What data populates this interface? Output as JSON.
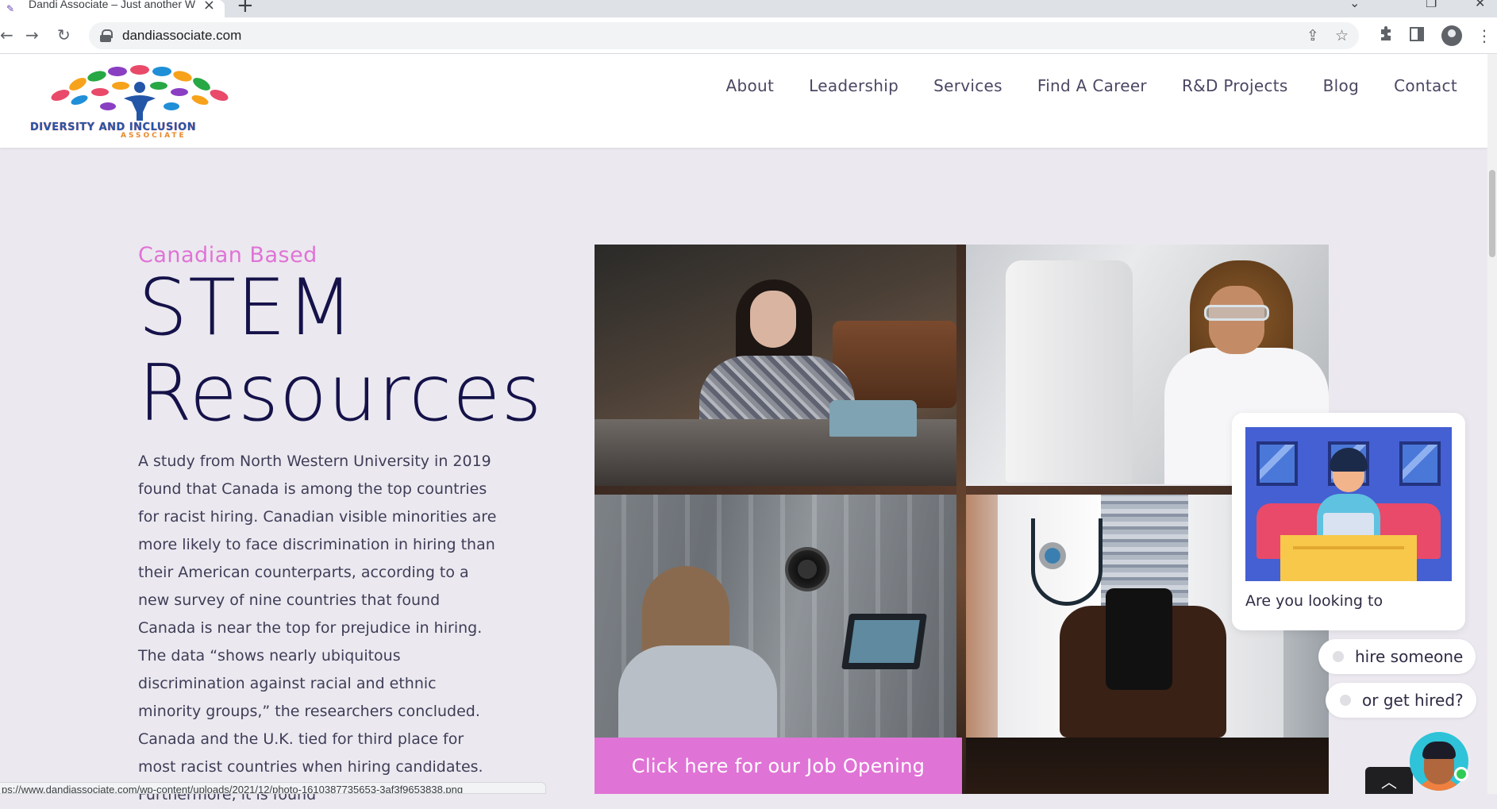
{
  "browser": {
    "tab_title": "Dandi Associate – Just another W",
    "url": "dandiassociate.com",
    "status_url": "ps://www.dandiassociate.com/wp-content/uploads/2021/12/photo-1610387735653-3af3f9653838.png"
  },
  "logo": {
    "line1": "DIVERSITY AND INCLUSION",
    "line2": "ASSOCIATE"
  },
  "nav": [
    "About",
    "Leadership",
    "Services",
    "Find A Career",
    "R&D Projects",
    "Blog",
    "Contact"
  ],
  "hero": {
    "eyebrow": "Canadian Based",
    "title_line1": "STEM",
    "title_line2": "Resources",
    "body": "A study from North Western University in 2019 found that Canada is among the top countries for racist hiring. Canadian visible minorities are more likely to face discrimination in hiring than their American counterparts, according to a new survey of nine countries that found Canada is near the top for prejudice in hiring. The data “shows nearly ubiquitous discrimination against racial and ethnic minority groups,” the researchers concluded. Canada and the U.K. tied for third place for most racist countries when hiring candidates. Furthermore, it is found"
  },
  "cta": {
    "label": "Click here for our Job Opening"
  },
  "chat": {
    "prompt": "Are you looking to",
    "options": [
      "hire someone",
      "or get hired?"
    ]
  },
  "colors": {
    "accent": "#e073d6",
    "title": "#15124a",
    "page_bg": "#ebe9ef"
  },
  "icons": {
    "back": "←",
    "forward": "→",
    "reload": "↻",
    "share": "⇪",
    "star": "☆",
    "extensions": "puzzle",
    "sidepanel": "▮",
    "menu": "⋮",
    "back_to_top": "︿"
  }
}
